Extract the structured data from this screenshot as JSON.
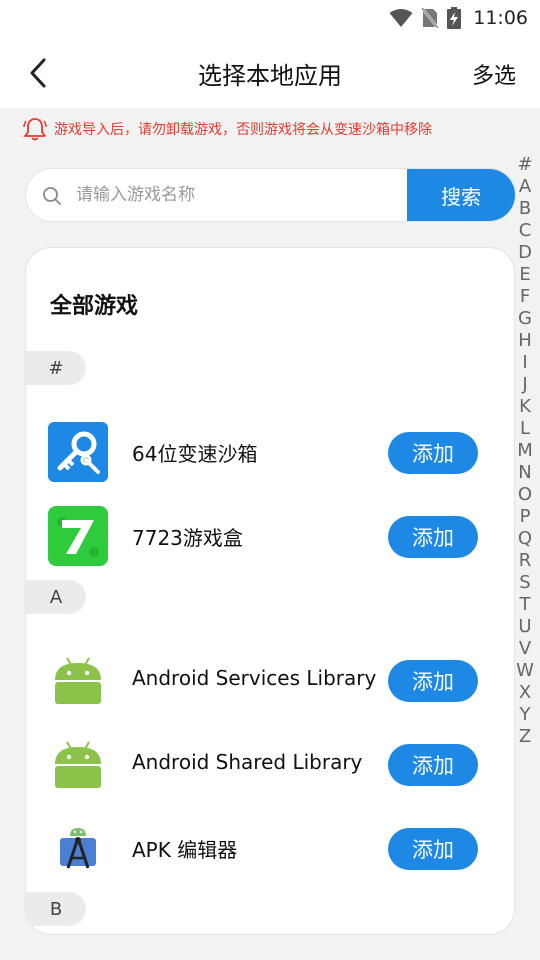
{
  "status_bar": {
    "time": "11:06"
  },
  "header": {
    "title": "选择本地应用",
    "multi_select": "多选"
  },
  "warning": {
    "text": "游戏导入后，请勿卸载游戏，否则游戏将会从变速沙箱中移除"
  },
  "search": {
    "placeholder": "请输入游戏名称",
    "button": "搜索"
  },
  "alphabet": [
    "#",
    "A",
    "B",
    "C",
    "D",
    "E",
    "F",
    "G",
    "H",
    "I",
    "J",
    "K",
    "L",
    "M",
    "N",
    "O",
    "P",
    "Q",
    "R",
    "S",
    "T",
    "U",
    "V",
    "W",
    "X",
    "Y",
    "Z"
  ],
  "section_title": "全部游戏",
  "groups": [
    {
      "letter": "#",
      "apps": [
        {
          "name": "64位变速沙箱",
          "button": "添加",
          "icon": "key-wrench-icon"
        },
        {
          "name": "7723游戏盒",
          "button": "添加",
          "icon": "green-seven-icon"
        }
      ]
    },
    {
      "letter": "A",
      "apps": [
        {
          "name": "Android Services Library",
          "button": "添加",
          "icon": "android-icon"
        },
        {
          "name": "Android Shared Library",
          "button": "添加",
          "icon": "android-icon"
        },
        {
          "name": "APK 编辑器",
          "button": "添加",
          "icon": "android-studio-icon"
        }
      ]
    },
    {
      "letter": "B",
      "apps": []
    }
  ],
  "colors": {
    "accent": "#1e88e5",
    "warning": "#e83a2f",
    "android_green": "#8bc34a"
  }
}
